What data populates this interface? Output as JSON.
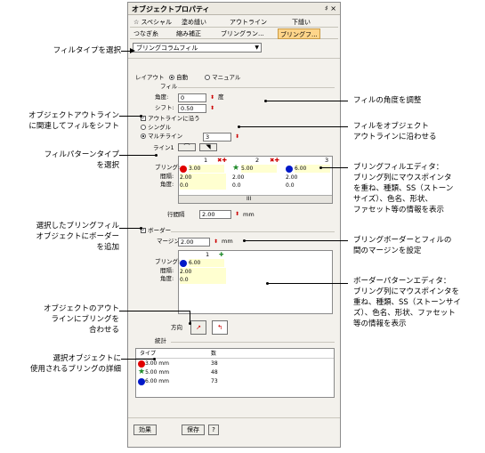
{
  "panel": {
    "title": "オブジェクトプロパティ",
    "title_controls": "♯ ×",
    "tabs_row1": [
      "☆ スペシャル",
      "塗め縫い",
      "アウトライン",
      "下縫い"
    ],
    "tabs_row2": [
      "つなぎ糸",
      "縮み補正",
      "ブリングラン...",
      "ブリングフ..."
    ],
    "fill_type_value": "ブリングコラムフィル",
    "layout_label": "レイアウト",
    "layout_auto": "自動",
    "layout_manual": "マニュアル",
    "fill_group": "フィル",
    "angle_label": "角度:",
    "angle_value": "0",
    "angle_unit": "度",
    "shift_label": "シフト:",
    "shift_value": "0.50",
    "follow_outline": "アウトラインに沿う",
    "single_label": "シングル",
    "multi_label": "マルチライン",
    "multi_value": "3",
    "line_group": "ライン1",
    "editor1": {
      "col_nums": [
        "1",
        "2",
        "3"
      ],
      "row_labels": [
        "ブリング:",
        "間隔:",
        "角度:"
      ],
      "sizes": [
        "3.00",
        "5.00",
        "6.00"
      ],
      "spacing": [
        "2.00",
        "2.00",
        "2.00"
      ],
      "angles": [
        "0.0",
        "0.0",
        "0.0"
      ],
      "scroll_label": "III"
    },
    "row_spacing_label": "行間隔",
    "row_spacing_value": "2.00",
    "row_spacing_unit": "mm",
    "border_label": "ボーダー",
    "margin_label": "マージン:",
    "margin_value": "2.00",
    "margin_unit": "mm",
    "editor2": {
      "col_num": "1",
      "row_labels": [
        "ブリング:",
        "間隔:",
        "角度:"
      ],
      "size": "6.00",
      "spacing": "2.00",
      "angle": "0.0"
    },
    "direction_label": "方向",
    "stats_group": "統計",
    "stats_headers": [
      "タイプ",
      "数"
    ],
    "stats_rows": [
      {
        "type": "3.00 mm",
        "count": "38",
        "color": "#e00000",
        "shape": "circle"
      },
      {
        "type": "5.00 mm",
        "count": "48",
        "color": "#1f8a2a",
        "shape": "star"
      },
      {
        "type": "6.00 mm",
        "count": "73",
        "color": "#0018c8",
        "shape": "circle"
      }
    ],
    "btn_effect": "効果",
    "btn_save": "保存",
    "btn_help": "?"
  },
  "annotations": {
    "left1": "フィルタイプを選択",
    "left2a": "オブジェクトアウトライン",
    "left2b": "に関連してフィルをシフト",
    "left3a": "フィルパターンタイプ",
    "left3b": "を選択",
    "left4a": "選択したブリングフィル",
    "left4b": "オブジェクトにボーダー",
    "left4c": "を追加",
    "left5a": "オブジェクトのアウト",
    "left5b": "ラインにブリングを",
    "left5c": "合わせる",
    "left6a": "選択オブジェクトに",
    "left6b": "使用されるブリングの詳細",
    "right1": "フィルの角度を調整",
    "right2a": "フィルをオブジェクト",
    "right2b": "アウトラインに沿わせる",
    "right3a": "ブリングフィルエディタ：",
    "right3b": "ブリング列にマウスポインタ",
    "right3c": "を重ね、種類、SS（ストーン",
    "right3d": "サイズ）、色名、形状、",
    "right3e": "ファセット等の情報を表示",
    "right4a": "ブリングボーダーとフィルの",
    "right4b": "間のマージンを設定",
    "right5a": "ボーダーパターンエディタ：",
    "right5b": "ブリング列にマウスポインタを",
    "right5c": "重ね、種類、SS（ストーンサイ",
    "right5d": "ズ）、色名、形状、ファセット",
    "right5e": "等の情報を表示"
  },
  "colors": {
    "red": "#e00000",
    "green": "#1f8a2a",
    "blue": "#0018c8",
    "tab_highlight": "#ffd58a"
  }
}
